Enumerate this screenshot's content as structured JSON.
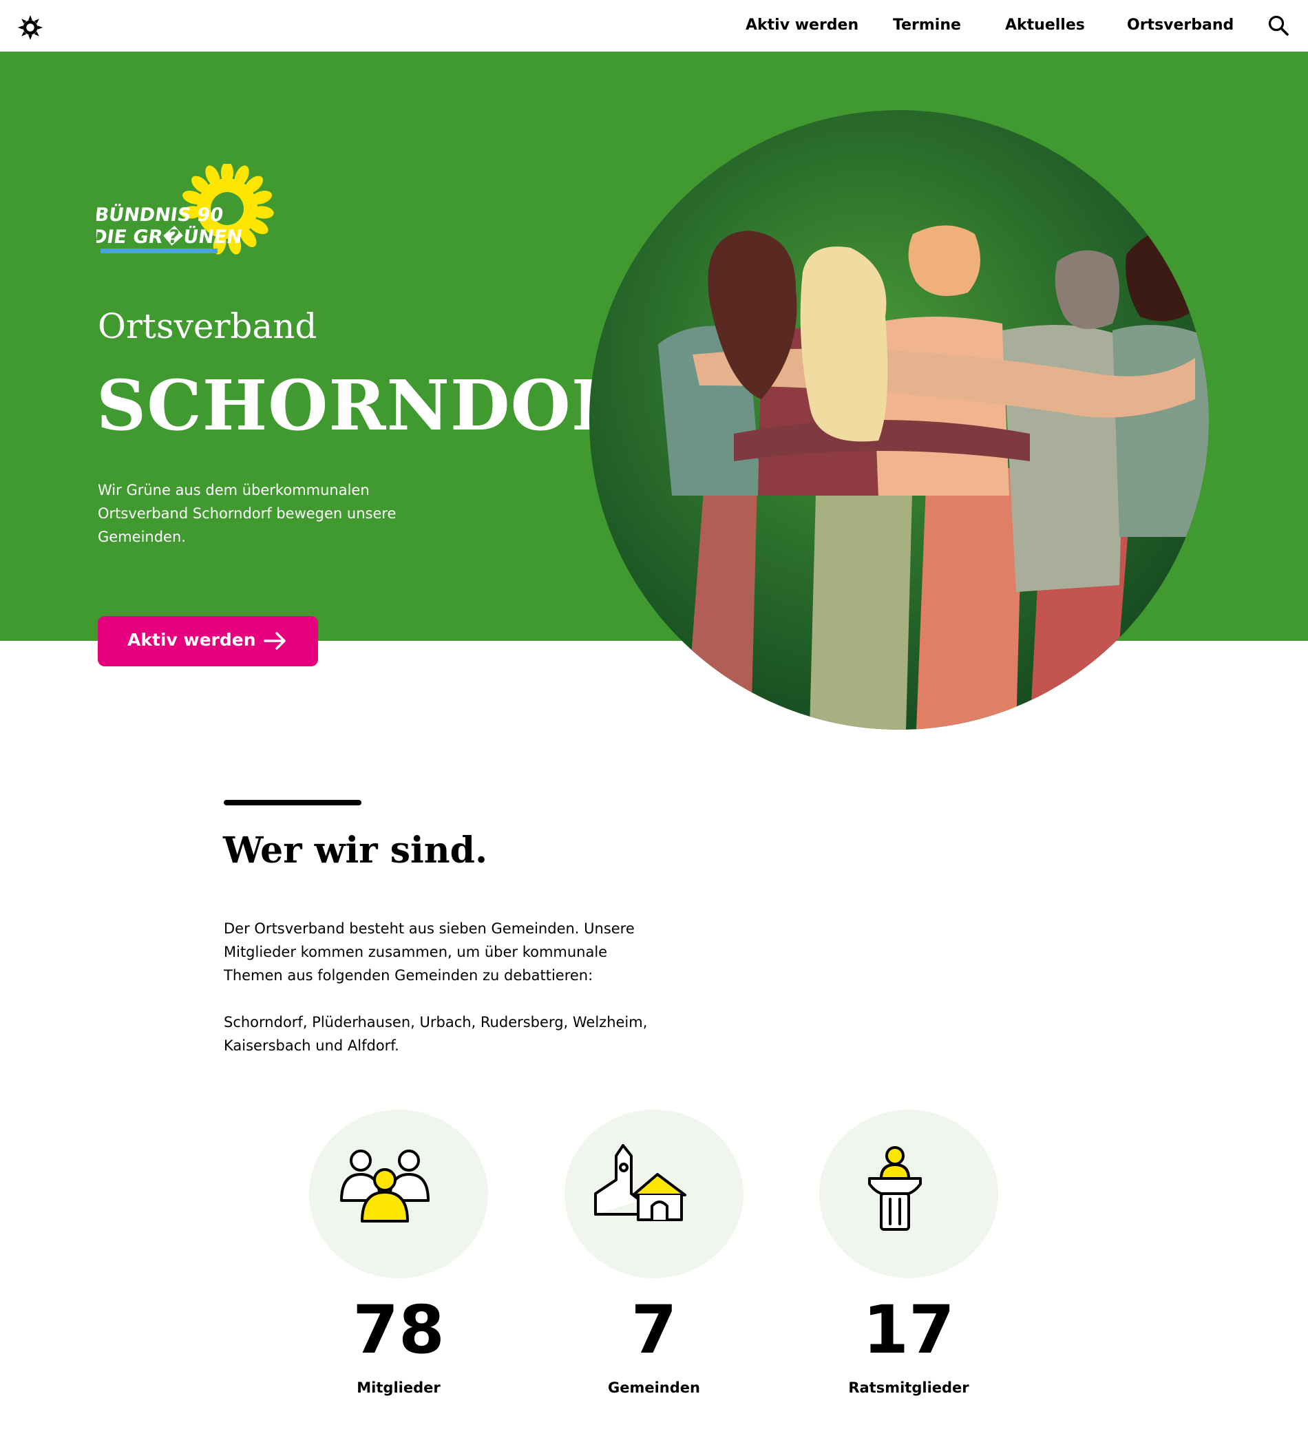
{
  "header": {
    "nav": [
      "Aktiv werden",
      "Termine",
      "Aktuelles",
      "Ortsverband"
    ]
  },
  "hero": {
    "logo_text": [
      "BÜNDNIS 90",
      "DIE GRÜNEN"
    ],
    "kicker": "Ortsverband",
    "title": "SCHORNDORF",
    "text": "Wir Grüne aus dem überkommunalen Ortsverband Schorndorf bewegen unsere Gemeinden.",
    "cta_label": "Aktiv werden"
  },
  "about": {
    "title": "Wer wir sind.",
    "paragraphs": [
      "Der Ortsverband besteht aus sieben Gemeinden. Unsere Mitglieder kommen zusammen, um über kommunale Themen aus folgenden Gemeinden zu debattieren:",
      "Schorndorf, Plüderhausen, Urbach, Rudersberg, Welzheim, Kaisersbach und Alfdorf."
    ]
  },
  "stats": [
    {
      "value": "78",
      "label": "Mitglieder",
      "icon": "members-icon"
    },
    {
      "value": "7",
      "label": "Gemeinden",
      "icon": "municipality-icon"
    },
    {
      "value": "17",
      "label": "Ratsmitglieder",
      "icon": "council-lectern-icon"
    }
  ],
  "colors": {
    "hero_green": "#409a2f",
    "cta_magenta": "#e6007e",
    "sunflower_yellow": "#ffe600",
    "icon_yellow": "#ffe600",
    "stat_circle": "#f0f6ed"
  }
}
